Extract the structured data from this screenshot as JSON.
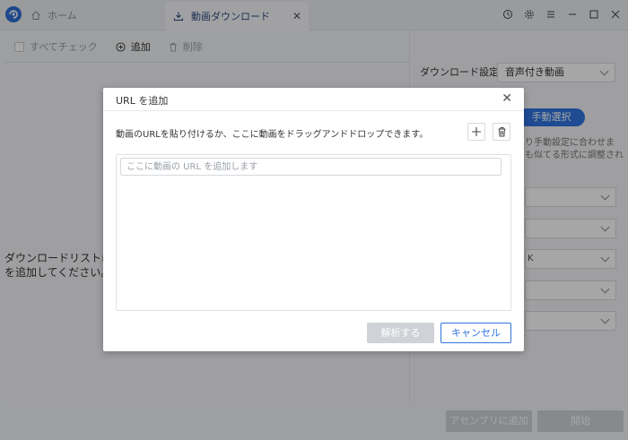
{
  "titlebar": {
    "home_tab_label": "ホーム",
    "download_tab_label": "動画ダウンロード",
    "close_glyph": "✕"
  },
  "toolbar": {
    "select_all_label": "すべてチェック",
    "add_label": "追加",
    "delete_label": "削除"
  },
  "main": {
    "empty_line1": "ダウンロードリストに動",
    "empty_line2": "を追加してください。"
  },
  "right_panel": {
    "download_setting_label": "ダウンロード設定:",
    "download_setting_value": "音声付き動画",
    "manual_select_label": "手動選択",
    "hint_line1": "り手動設定に合わせま",
    "hint_line2": "も似てる形式に調整され",
    "select_fragment": "K"
  },
  "bottom": {
    "assembly_label": "アセンブリに追加",
    "start_label": "開始"
  },
  "dialog": {
    "title": "URL を追加",
    "close_glyph": "✕",
    "description": "動画のURLを貼り付けるか、ここに動画をドラッグアンドドロップできます。",
    "url_input_value": "",
    "url_input_placeholder": "ここに動画の URL を追加します",
    "analyze_label": "解析する",
    "cancel_label": "キャンセル"
  },
  "colors": {
    "accent": "#2f74e0",
    "disabled_button": "#cfd3d8"
  }
}
